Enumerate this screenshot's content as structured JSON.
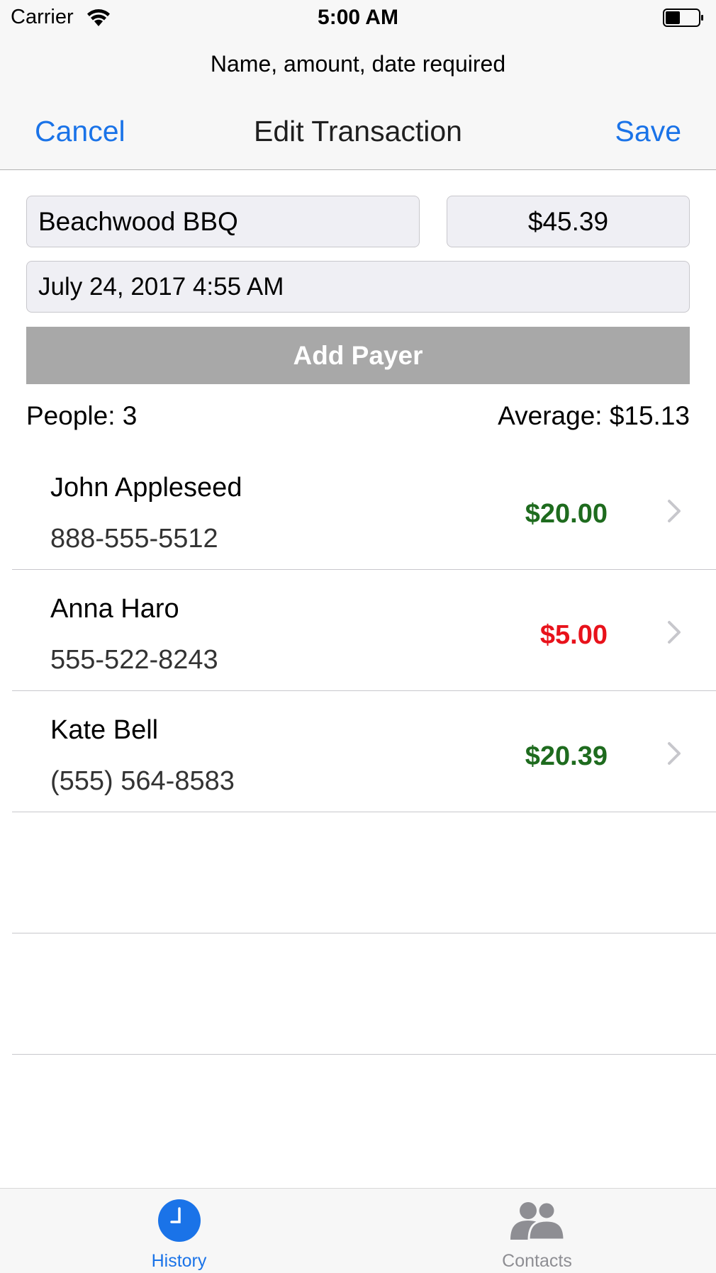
{
  "status_bar": {
    "carrier": "Carrier",
    "time": "5:00 AM"
  },
  "prompt": "Name, amount, date required",
  "nav": {
    "cancel_label": "Cancel",
    "title": "Edit Transaction",
    "save_label": "Save"
  },
  "form": {
    "name_value": "Beachwood BBQ",
    "amount_value": "$45.39",
    "date_value": "July 24, 2017 4:55 AM",
    "add_payer_label": "Add Payer"
  },
  "summary": {
    "people": "People: 3",
    "average": "Average: $15.13"
  },
  "payers": [
    {
      "name": "John Appleseed",
      "phone": "888-555-5512",
      "amount": "$20.00",
      "color": "#1e6b1e"
    },
    {
      "name": "Anna Haro",
      "phone": "555-522-8243",
      "amount": "$5.00",
      "color": "#e8121b"
    },
    {
      "name": "Kate Bell",
      "phone": "(555) 564-8583",
      "amount": "$20.39",
      "color": "#1e6b1e"
    }
  ],
  "tabs": [
    {
      "label": "History",
      "icon": "clock-icon",
      "active": true,
      "color": "#1a73e8"
    },
    {
      "label": "Contacts",
      "icon": "people-icon",
      "active": false,
      "color": "#8e8e93"
    }
  ],
  "colors": {
    "accent": "#1a73e8",
    "positive": "#1e6b1e",
    "negative": "#e8121b",
    "disabled_button": "#a8a8a8"
  }
}
